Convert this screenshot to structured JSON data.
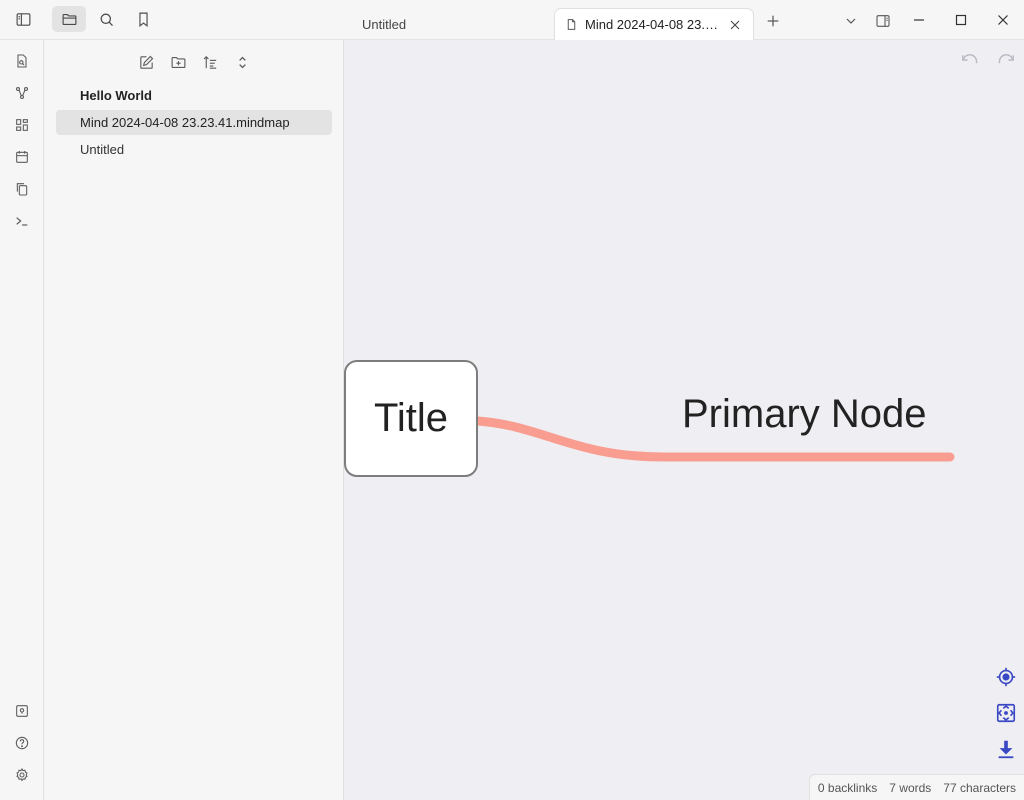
{
  "header": {
    "sidebar_toggle_icon": "sidebar-left-icon",
    "nav_tabs": [
      {
        "id": "files",
        "icon": "folder-icon",
        "active": true
      },
      {
        "id": "search",
        "icon": "search-icon",
        "active": false
      },
      {
        "id": "bookmarks",
        "icon": "bookmark-icon",
        "active": false
      }
    ]
  },
  "ribbon": {
    "top_items": [
      "quick-switcher-icon",
      "graph-view-icon",
      "canvas-icon",
      "daily-note-icon",
      "templates-icon",
      "command-palette-icon"
    ],
    "bottom_items": [
      "vault-icon",
      "help-icon",
      "settings-icon"
    ]
  },
  "explorer": {
    "tools": [
      "new-note-icon",
      "new-folder-icon",
      "sort-icon",
      "collapse-icon"
    ],
    "files": [
      {
        "label": "Hello World",
        "bold": true,
        "selected": false
      },
      {
        "label": "Mind 2024-04-08 23.23.41.mindmap",
        "bold": false,
        "selected": true
      },
      {
        "label": "Untitled",
        "bold": false,
        "selected": false
      }
    ]
  },
  "tabs": {
    "inactive_label": "Untitled",
    "active_label": "Mind 2024-04-08 23.2..."
  },
  "mindmap": {
    "root_label": "Title",
    "primary_label": "Primary Node",
    "edge_color": "#f99d91",
    "accent_color": "#3b48c4"
  },
  "status": {
    "backlinks": "0 backlinks",
    "words": "7 words",
    "characters": "77 characters"
  }
}
